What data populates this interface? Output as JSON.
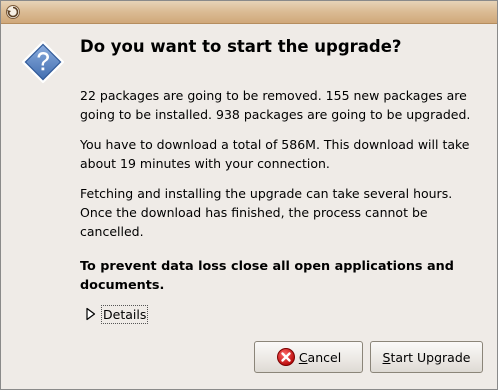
{
  "window": {
    "titlebar_icon": "ubuntu-update-icon",
    "dialog_icon": "question-icon"
  },
  "dialog": {
    "heading": "Do you want to start the upgrade?",
    "paragraph1": "22 packages are going to be removed. 155 new packages are going to be installed. 938 packages are going to be upgraded.",
    "paragraph2": "You have to download a total of 586M. This download will take about 19 minutes with your connection.",
    "paragraph3": "Fetching and installing the upgrade can take several hours. Once the download has finished, the process cannot be cancelled.",
    "warning": "To prevent data loss close all open applications and documents."
  },
  "details": {
    "label": "Details",
    "expanded": false
  },
  "buttons": {
    "cancel": {
      "mnemonic": "C",
      "rest": "ancel",
      "icon": "cancel-icon"
    },
    "start": {
      "mnemonic": "S",
      "rest": "tart Upgrade"
    }
  },
  "colors": {
    "titlebar": "#dcbd96",
    "window_bg": "#efebe7",
    "question_icon": "#4a76b5",
    "cancel_icon": "#cc0000"
  }
}
